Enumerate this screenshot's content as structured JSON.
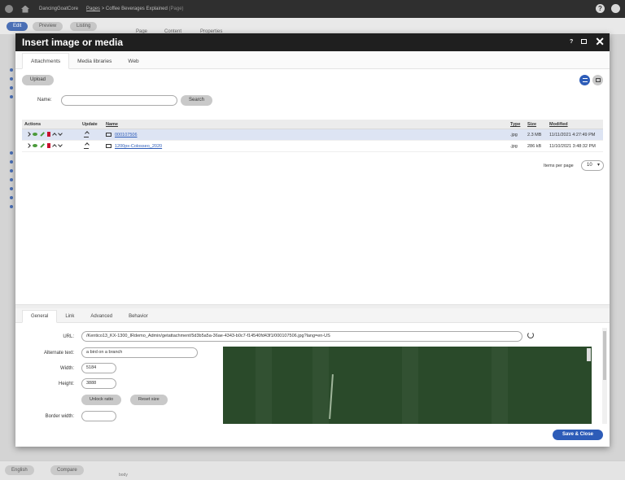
{
  "topbar": {
    "site": "DancingGoatCore",
    "crumb_link": "Pages",
    "crumb_current": "Coffee Beverages Explained",
    "crumb_type": "(Page)",
    "help": "?"
  },
  "subbar": {
    "edit": "Edit",
    "preview": "Preview",
    "listing": "Listing",
    "tab_page": "Page",
    "tab_content": "Content",
    "tab_properties": "Properties"
  },
  "bottombar": {
    "language": "English",
    "compare": "Compare",
    "body_label": "body"
  },
  "dialog": {
    "title": "Insert image or media",
    "help": "?",
    "tabs": [
      "Attachments",
      "Media libraries",
      "Web"
    ],
    "upload": "Upload",
    "name_label": "Name:",
    "search": "Search",
    "table": {
      "headers": {
        "actions": "Actions",
        "update": "Update",
        "name": "Name",
        "type": "Type",
        "size": "Size",
        "modified": "Modified"
      },
      "rows": [
        {
          "name": "000107506",
          "type": ".jpg",
          "size": "2.3 MB",
          "modified": "11/11/2021 4:27:49 PM"
        },
        {
          "name": "1200px-Colosseo_2020",
          "type": ".jpg",
          "size": "286 kB",
          "modified": "11/10/2021 3:48:32 PM"
        }
      ]
    },
    "items_per_page_label": "Items per page",
    "items_per_page": "10",
    "lower_tabs": [
      "General",
      "Link",
      "Advanced",
      "Behavior"
    ],
    "fields": {
      "url_label": "URL:",
      "url_value": "/Kentico13_KX-1300_IRdemo_Admin/getattachment/5d3b5a5a-36ae-4343-b0c7-f14540fd43f1/000107506.jpg?lang=en-US",
      "alt_label": "Alternate text:",
      "alt_value": "a bird on a branch",
      "width_label": "Width:",
      "width_value": "5184",
      "height_label": "Height:",
      "height_value": "3888",
      "unlock": "Unlock ratio",
      "reset": "Reset size",
      "border_label": "Border width:",
      "border_value": ""
    },
    "save_close": "Save & Close"
  }
}
